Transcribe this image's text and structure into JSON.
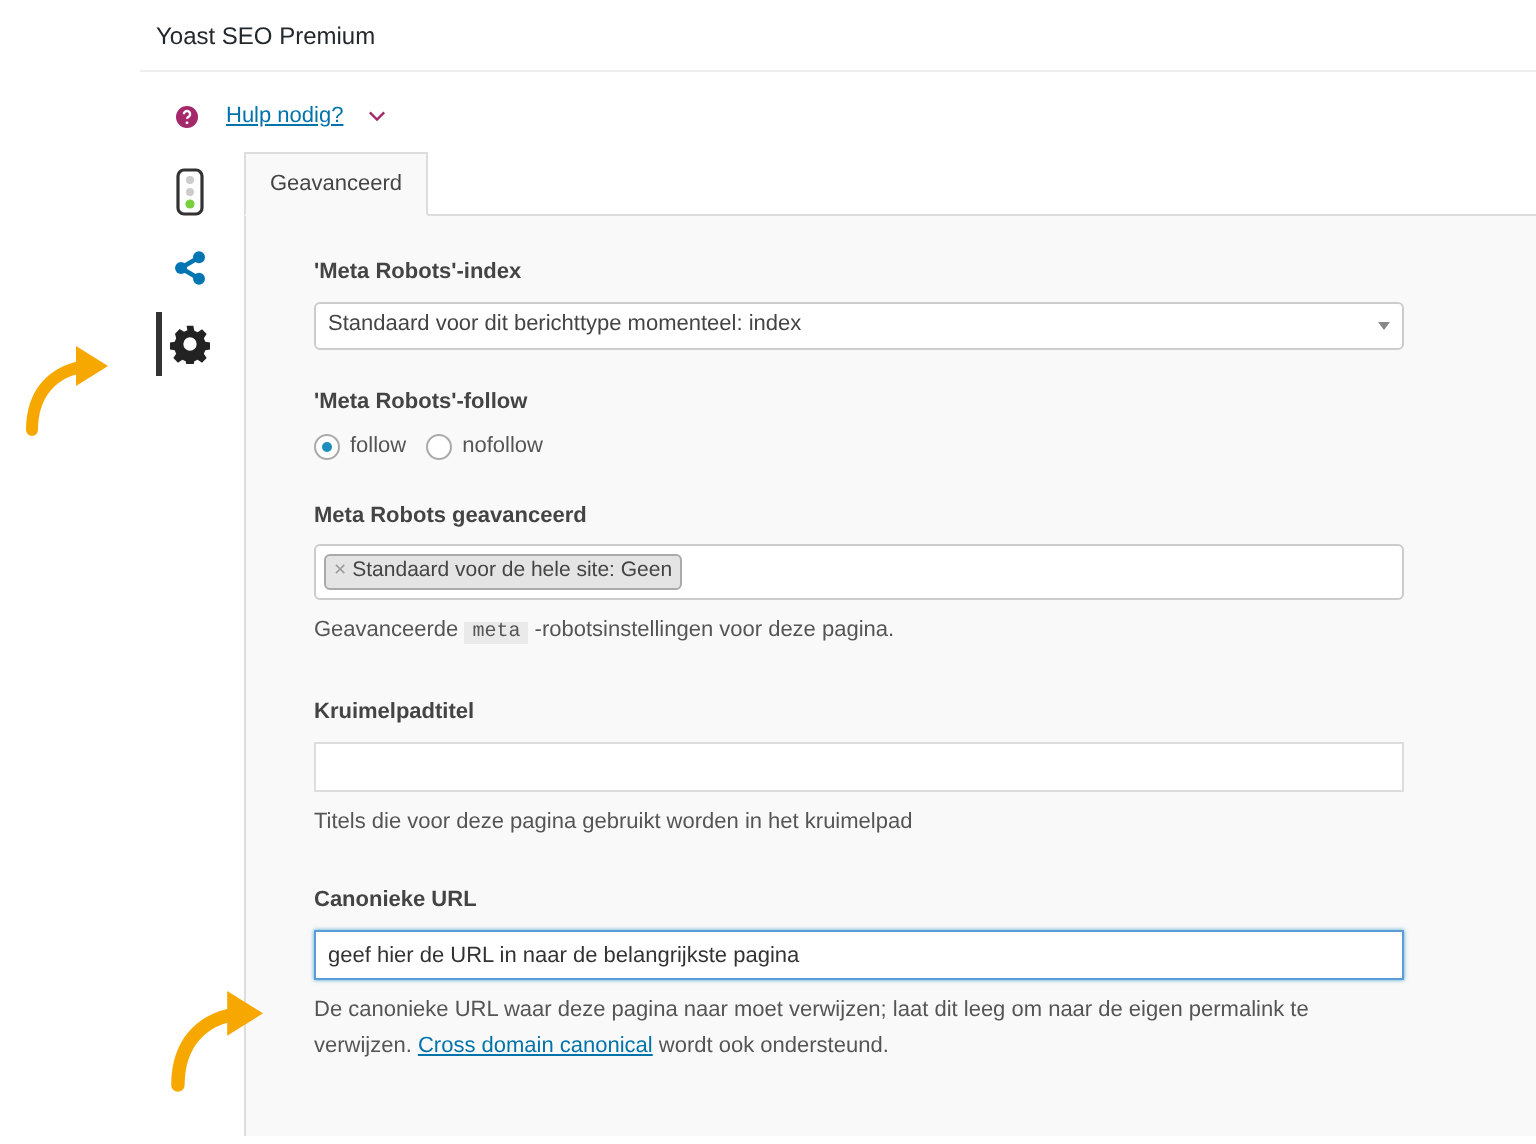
{
  "header": {
    "title": "Yoast SEO Premium"
  },
  "help": {
    "label": "Hulp nodig?"
  },
  "sidebar": {
    "items": [
      {
        "kind": "traffic-light",
        "selected": false
      },
      {
        "kind": "share",
        "selected": false
      },
      {
        "kind": "gear",
        "selected": true
      }
    ]
  },
  "tabs": [
    {
      "label": "Geavanceerd",
      "selected": true
    }
  ],
  "form": {
    "robots_index": {
      "label": "'Meta Robots'-index",
      "value": "Standaard voor dit berichttype momenteel: index"
    },
    "robots_follow": {
      "label": "'Meta Robots'-follow",
      "options": [
        {
          "label": "follow",
          "selected": true
        },
        {
          "label": "nofollow",
          "selected": false
        }
      ]
    },
    "robots_advanced": {
      "label": "Meta Robots geavanceerd",
      "tags": [
        {
          "remove": "×",
          "label": "Standaard voor de hele site: Geen"
        }
      ],
      "description": [
        {
          "kind": "text",
          "text": "Geavanceerde "
        },
        {
          "kind": "code",
          "text": "meta"
        },
        {
          "kind": "text",
          "text": " -robotsinstellingen voor deze pagina."
        }
      ]
    },
    "breadcrumb_title": {
      "label": "Kruimelpadtitel",
      "description": [
        {
          "kind": "text",
          "text": "Titels die voor deze pagina gebruikt worden in het kruimelpad"
        }
      ]
    },
    "canonical": {
      "label": "Canonieke URL",
      "value": "geef hier de URL in naar de belangrijkste pagina",
      "focused": true,
      "description": [
        {
          "kind": "text",
          "text": "De canonieke URL waar deze pagina naar moet verwijzen; laat dit leeg om naar de eigen permalink te verwijzen. "
        },
        {
          "kind": "link",
          "text": "Cross domain canonical"
        },
        {
          "kind": "text",
          "text": " wordt ook ondersteund."
        }
      ]
    }
  }
}
